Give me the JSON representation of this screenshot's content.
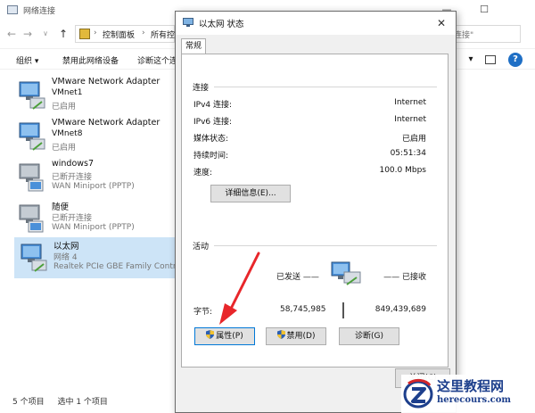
{
  "explorer": {
    "title": "网络连接",
    "window_controls": [
      "—",
      "☐"
    ],
    "nav": {
      "back": "←",
      "forward": "→",
      "dropdown": "∨",
      "up": "↑"
    },
    "breadcrumb": [
      "控制面板",
      "所有控"
    ],
    "breadcrumb_sep": "›",
    "search_placeholder": "连接\"",
    "commands": [
      "组织 ▾",
      "禁用此网络设备",
      "诊断这个连"
    ],
    "view_dropdown": "▾",
    "connections": [
      {
        "name": "VMware Network Adapter",
        "sub": "VMnet1",
        "status": "已启用",
        "device": "",
        "icon": "network-adapter-icon",
        "selected": false
      },
      {
        "name": "VMware Network Adapter",
        "sub": "VMnet8",
        "status": "已启用",
        "device": "",
        "icon": "network-adapter-icon",
        "selected": false
      },
      {
        "name": "windows7",
        "sub": "",
        "status": "已断开连接",
        "device": "WAN Miniport (PPTP)",
        "icon": "vpn-connection-icon",
        "selected": false
      },
      {
        "name": "随便",
        "sub": "",
        "status": "已断开连接",
        "device": "WAN Miniport (PPTP)",
        "icon": "vpn-connection-icon",
        "selected": false
      },
      {
        "name": "以太网",
        "sub": "",
        "status": "网络 4",
        "device": "Realtek PCIe GBE Family Contr...",
        "icon": "network-adapter-icon",
        "selected": true
      }
    ],
    "status_count": "5 个项目",
    "status_selected": "选中 1 个项目"
  },
  "dialog": {
    "title": "以太网 状态",
    "close_glyph": "✕",
    "tab": "常规",
    "connection_group": "连接",
    "rows": [
      {
        "label": "IPv4 连接:",
        "value": "Internet"
      },
      {
        "label": "IPv6 连接:",
        "value": "Internet"
      },
      {
        "label": "媒体状态:",
        "value": "已启用"
      },
      {
        "label": "持续时间:",
        "value": "05:51:34"
      },
      {
        "label": "速度:",
        "value": "100.0 Mbps"
      }
    ],
    "details_button": "详细信息(E)...",
    "activity_group": "活动",
    "sent_label": "已发送 ——",
    "received_label": "—— 已接收",
    "bytes_label": "字节:",
    "bytes_sent": "58,745,985",
    "bytes_received": "849,439,689",
    "properties_button": "属性(P)",
    "disable_button": "禁用(D)",
    "diagnose_button": "诊断(G)",
    "close_button": "关闭(C)"
  },
  "watermark": {
    "cn": "这里教程网",
    "en": "herecours.com"
  },
  "colors": {
    "selection": "#cde4f7",
    "help": "#1f6fc5",
    "arrow": "#e8262a",
    "watermark": "#1d3f8c"
  }
}
